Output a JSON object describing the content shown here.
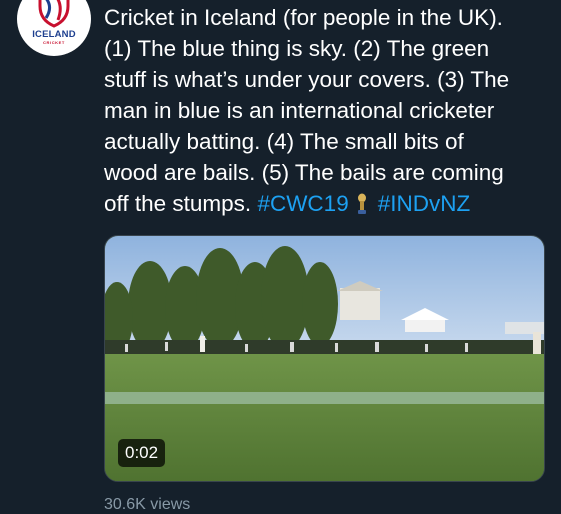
{
  "avatar": {
    "name": "ICELAND",
    "sub": "CRICKET"
  },
  "tweet": {
    "lines": [
      "Cricket in Iceland (for people in the UK).",
      "(1) The blue thing is sky. (2) The green",
      "stuff is what’s under your covers. (3) The",
      "man in blue is an international cricketer",
      "actually batting. (4) The small bits of",
      "wood are bails. (5) The bails are coming"
    ],
    "last_line_text": "off the stumps.",
    "hashtag_1": "#CWC19",
    "trophy_icon": "cricket-world-cup-trophy-icon",
    "hashtag_2": "#INDvNZ"
  },
  "video": {
    "duration": "0:02"
  },
  "views": "30.6K views",
  "colors": {
    "background": "#15202b",
    "hashtag": "#1da1f2",
    "muted": "#8899a6"
  }
}
